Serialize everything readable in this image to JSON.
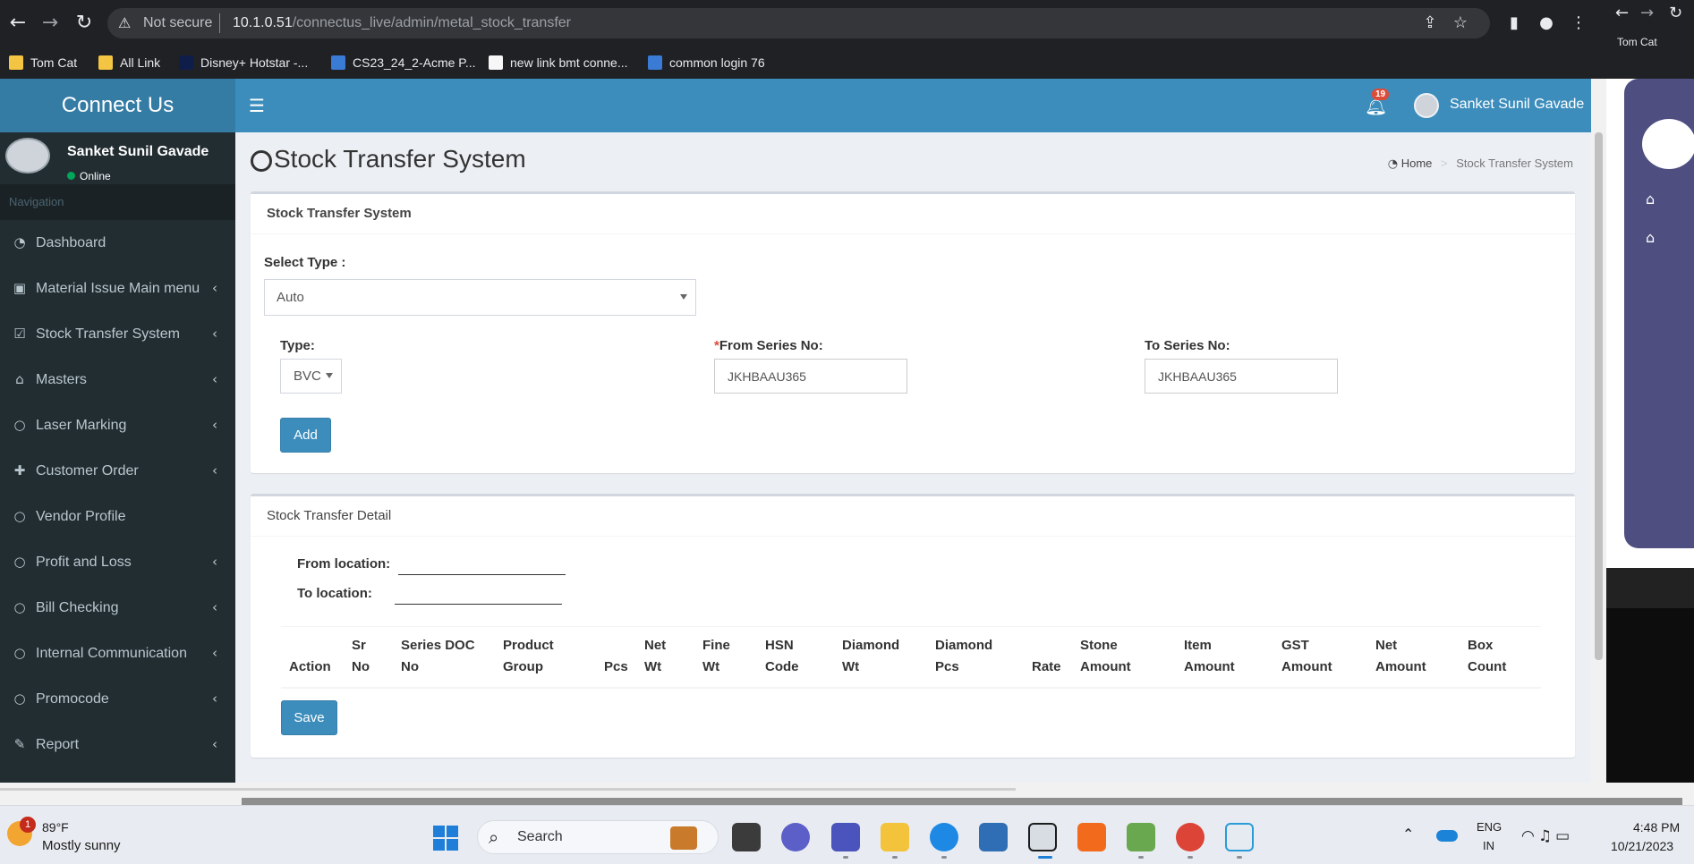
{
  "browser": {
    "not_secure": "Not secure",
    "url_host": "10.1.0.51",
    "url_path": "/connectus_live/admin/metal_stock_transfer",
    "bookmarks": [
      "Tom Cat",
      "All Link",
      "Disney+ Hotstar -...",
      "CS23_24_2-Acme P...",
      "new link bmt conne...",
      "common login 76"
    ],
    "side_bookmark": "Tom Cat"
  },
  "app": {
    "brand": "Connect Us",
    "notification_count": "19",
    "top_user": "Sanket Sunil Gavade"
  },
  "sidebar": {
    "user_name": "Sanket Sunil Gavade",
    "status": "Online",
    "nav_header": "Navigation",
    "items": [
      {
        "label": "Dashboard",
        "icon": "dashboard-icon",
        "chevron": false
      },
      {
        "label": "Material Issue Main menu",
        "icon": "money-icon",
        "chevron": true
      },
      {
        "label": "Stock Transfer System",
        "icon": "check-square-icon",
        "chevron": true
      },
      {
        "label": "Masters",
        "icon": "home-icon",
        "chevron": true
      },
      {
        "label": "Laser Marking",
        "icon": "circle-icon",
        "chevron": true
      },
      {
        "label": "Customer Order",
        "icon": "plus-icon",
        "chevron": true
      },
      {
        "label": "Vendor Profile",
        "icon": "circle-icon",
        "chevron": false
      },
      {
        "label": "Profit and Loss",
        "icon": "circle-icon",
        "chevron": true
      },
      {
        "label": "Bill Checking",
        "icon": "circle-icon",
        "chevron": true
      },
      {
        "label": "Internal Communication",
        "icon": "circle-icon",
        "chevron": true
      },
      {
        "label": "Promocode",
        "icon": "circle-icon",
        "chevron": true
      },
      {
        "label": "Report",
        "icon": "pencil-icon",
        "chevron": true
      }
    ]
  },
  "page": {
    "title": "Stock Transfer System",
    "breadcrumb_home": "Home",
    "breadcrumb_current": "Stock Transfer System"
  },
  "form": {
    "box_title": "Stock Transfer System",
    "select_type_label": "Select Type :",
    "select_type_value": "Auto",
    "type_label": "Type:",
    "type_value": "BVC",
    "from_series_required": "*",
    "from_series_label": "From Series No:",
    "from_series_value": "JKHBAAU365",
    "to_series_label": "To Series No:",
    "to_series_value": "JKHBAAU365",
    "add_label": "Add"
  },
  "detail": {
    "box_title": "Stock Transfer Detail",
    "from_location_label": "From location:",
    "to_location_label": "To location:",
    "columns": [
      [
        "",
        "Action"
      ],
      [
        "Sr",
        "No"
      ],
      [
        "Series DOC",
        "No"
      ],
      [
        "Product",
        "Group"
      ],
      [
        "",
        "Pcs"
      ],
      [
        "Net",
        "Wt"
      ],
      [
        "Fine",
        "Wt"
      ],
      [
        "HSN",
        "Code"
      ],
      [
        "Diamond",
        "Wt"
      ],
      [
        "Diamond",
        "Pcs"
      ],
      [
        "",
        "Rate"
      ],
      [
        "Stone",
        "Amount"
      ],
      [
        "Item",
        "Amount"
      ],
      [
        "GST",
        "Amount"
      ],
      [
        "Net",
        "Amount"
      ],
      [
        "Box",
        "Count"
      ]
    ],
    "save_label": "Save"
  },
  "taskbar": {
    "weather_badge": "1",
    "temperature": "89°F",
    "weather": "Mostly sunny",
    "search": "Search",
    "lang1": "ENG",
    "lang2": "IN",
    "time": "4:48 PM",
    "date": "10/21/2023"
  }
}
